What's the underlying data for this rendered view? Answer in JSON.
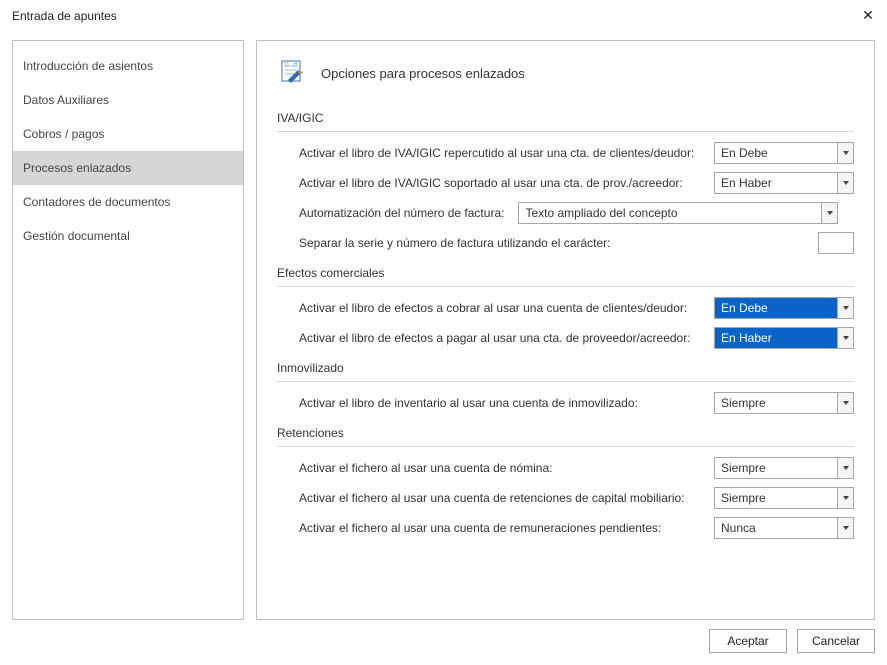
{
  "window": {
    "title": "Entrada de apuntes"
  },
  "sidebar": {
    "items": [
      {
        "label": "Introducción de asientos"
      },
      {
        "label": "Datos Auxiliares"
      },
      {
        "label": "Cobros / pagos"
      },
      {
        "label": "Procesos enlazados"
      },
      {
        "label": "Contadores de documentos"
      },
      {
        "label": "Gestión documental"
      }
    ],
    "selected_index": 3
  },
  "page": {
    "title": "Opciones para procesos enlazados"
  },
  "sections": {
    "iva": {
      "title": "IVA/IGIC",
      "row1_label": "Activar el libro de IVA/IGIC repercutido al usar una cta. de clientes/deudor:",
      "row1_value": "En Debe",
      "row2_label": "Activar el libro de IVA/IGIC soportado al usar una cta. de prov./acreedor:",
      "row2_value": "En Haber",
      "row3_label": "Automatización del número de factura:",
      "row3_value": "Texto ampliado del concepto",
      "row4_label": "Separar la serie y número de factura utilizando el carácter:",
      "row4_value": ""
    },
    "efectos": {
      "title": "Efectos comerciales",
      "row1_label": "Activar el libro de efectos a cobrar al usar una cuenta de clientes/deudor:",
      "row1_value": "En Debe",
      "row2_label": "Activar el libro de efectos a pagar al usar una cta. de proveedor/acreedor:",
      "row2_value": "En Haber"
    },
    "inmov": {
      "title": "Inmovilizado",
      "row1_label": "Activar el libro de inventario al usar una cuenta de inmovilizado:",
      "row1_value": "Siempre"
    },
    "ret": {
      "title": "Retenciones",
      "row1_label": "Activar el fichero al usar una cuenta de nómina:",
      "row1_value": "Siempre",
      "row2_label": "Activar el fichero al usar una cuenta de retenciones de capital mobiliario:",
      "row2_value": "Siempre",
      "row3_label": "Activar el fichero al usar una cuenta de remuneraciones pendientes:",
      "row3_value": "Nunca"
    }
  },
  "footer": {
    "accept": "Aceptar",
    "cancel": "Cancelar"
  }
}
